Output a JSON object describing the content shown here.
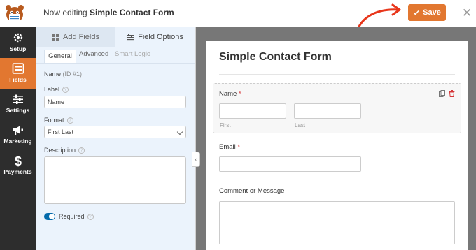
{
  "topbar": {
    "editing_prefix": "Now editing",
    "form_name": "Simple Contact Form",
    "save_label": "Save",
    "close_glyph": "✕"
  },
  "sidebar": {
    "items": [
      {
        "label": "Setup",
        "icon": "gear-icon",
        "active": false
      },
      {
        "label": "Fields",
        "icon": "fields-icon",
        "active": true
      },
      {
        "label": "Settings",
        "icon": "sliders-icon",
        "active": false
      },
      {
        "label": "Marketing",
        "icon": "megaphone-icon",
        "active": false
      },
      {
        "label": "Payments",
        "icon": "dollar-icon",
        "active": false
      }
    ]
  },
  "panel": {
    "tabs": [
      {
        "label": "Add Fields",
        "icon": "grid-icon"
      },
      {
        "label": "Field Options",
        "icon": "options-icon"
      }
    ],
    "subtabs": [
      "General",
      "Advanced",
      "Smart Logic"
    ],
    "field_heading": "Name",
    "field_id": "(ID #1)",
    "label_title": "Label",
    "label_value": "Name",
    "format_title": "Format",
    "format_value": "First Last",
    "description_title": "Description",
    "required_label": "Required",
    "required_on": true
  },
  "preview": {
    "form_title": "Simple Contact Form",
    "name_label": "Name",
    "first_sub": "First",
    "last_sub": "Last",
    "email_label": "Email",
    "comment_label": "Comment or Message",
    "required_mark": "*",
    "collapse_glyph": "‹"
  },
  "colors": {
    "accent": "#e27730",
    "sidebar_bg": "#2d2d2d",
    "panel_bg": "#ebf3fc",
    "toggle": "#036aab",
    "required_star": "#d63638"
  }
}
